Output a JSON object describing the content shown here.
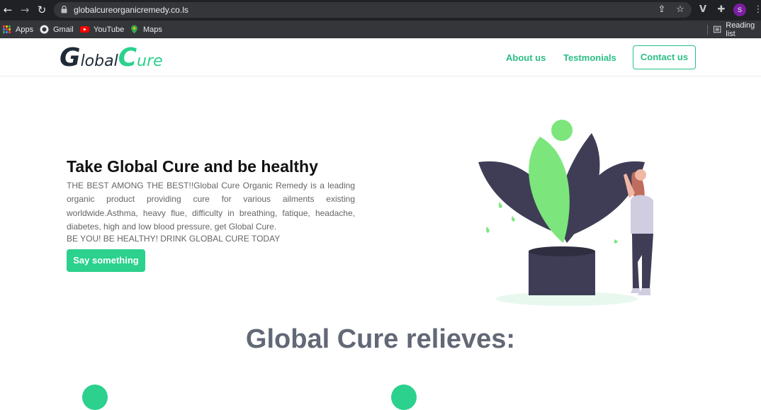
{
  "browser": {
    "url": "globalcureorganicremedy.co.ls",
    "profile_initial": "S",
    "bookmarks": [
      {
        "label": "Apps",
        "icon": "apps-grid-icon"
      },
      {
        "label": "Gmail",
        "icon": "google-icon"
      },
      {
        "label": "YouTube",
        "icon": "youtube-icon"
      },
      {
        "label": "Maps",
        "icon": "maps-icon"
      }
    ],
    "reading_list": "Reading list"
  },
  "site": {
    "logo": {
      "g": "G",
      "lobal": "lobal",
      "c": "C",
      "ure": "ure"
    },
    "nav": {
      "about": "About us",
      "testimonials": "Testmonials",
      "contact": "Contact us"
    },
    "hero": {
      "title": "Take Global Cure and be healthy",
      "text": "THE BEST AMONG THE BEST!!Global Cure Organic Remedy is a leading organic product providing cure for various ailments existing worldwide.Asthma, heavy flue, difficulty in breathing, fatique, headache, diabetes, high and low blood pressure, get Global Cure.",
      "tagline": "BE YOU! BE HEALTHY! DRINK GLOBAL CURE TODAY",
      "cta": "Say something"
    },
    "section_title": "Global Cure relieves:"
  },
  "colors": {
    "accent": "#2bd18d",
    "nav_green": "#2bbf85",
    "logo_dark": "#1f2a36",
    "logo_green": "#2bd18d",
    "plant_dark": "#3f3d56",
    "plant_green": "#7ce67c"
  }
}
